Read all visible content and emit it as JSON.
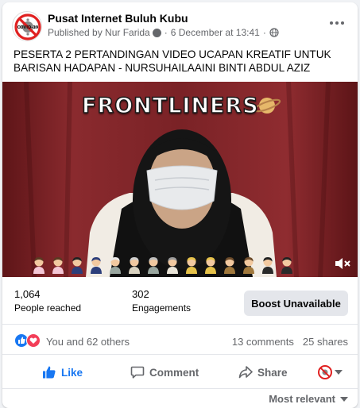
{
  "post": {
    "page_name": "Pusat Internet Buluh Kubu",
    "published_by": "Published by Nur Farida",
    "date": "6 December at 13:41",
    "avatar_logo_text": "COVID-19",
    "text": "PESERTA 2 PERTANDINGAN VIDEO UCAPAN KREATIF UNTUK BARISAN HADAPAN - NURSUHAILAAINI BINTI ABDUL AZIZ"
  },
  "video": {
    "overlay_title": "FRONTLINERS",
    "figure_count": 14,
    "colors": {
      "curtain": "#7c2326",
      "mask": "#e8eaec"
    }
  },
  "stats": {
    "reach_value": "1,064",
    "reach_label": "People reached",
    "engagements_value": "302",
    "engagements_label": "Engagements",
    "boost_label": "Boost Unavailable"
  },
  "reactions": {
    "summary": "You and 62 others",
    "comments": "13 comments",
    "shares": "25 shares",
    "icons": [
      "like-icon",
      "love-icon"
    ]
  },
  "actions": {
    "like": "Like",
    "comment": "Comment",
    "share": "Share"
  },
  "sort": {
    "label": "Most relevant"
  },
  "colors": {
    "accent": "#1877f2",
    "secondary_text": "#65676b",
    "love": "#f33e58",
    "logo_red": "#e02020"
  }
}
